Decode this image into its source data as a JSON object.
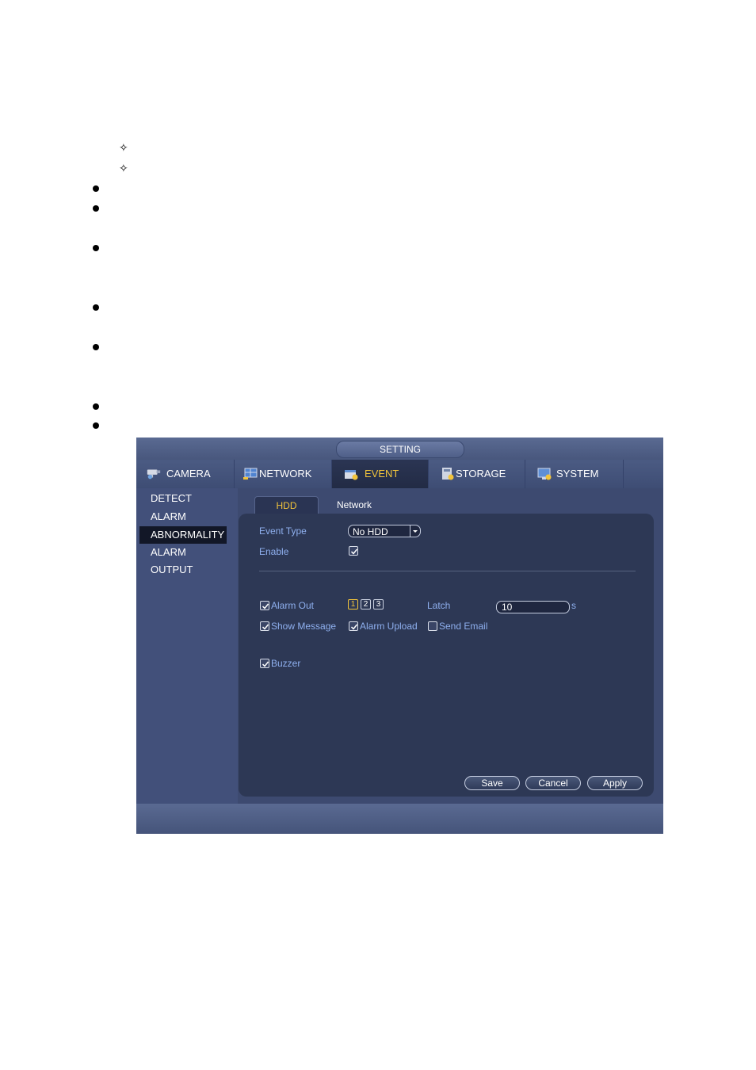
{
  "window": {
    "title": "SETTING",
    "tabs": [
      {
        "label": "CAMERA",
        "icon": "camera-icon"
      },
      {
        "label": "NETWORK",
        "icon": "network-icon"
      },
      {
        "label": "EVENT",
        "icon": "event-icon",
        "active": true
      },
      {
        "label": "STORAGE",
        "icon": "storage-icon"
      },
      {
        "label": "SYSTEM",
        "icon": "system-icon"
      }
    ],
    "sidebar": {
      "items": [
        {
          "label": "DETECT"
        },
        {
          "label": "ALARM"
        },
        {
          "label": "ABNORMALITY",
          "active": true
        },
        {
          "label": "ALARM OUTPUT"
        }
      ]
    },
    "subtabs": [
      {
        "label": "HDD",
        "active": true
      },
      {
        "label": "Network"
      }
    ],
    "form": {
      "event_type_label": "Event Type",
      "event_type_value": "No HDD",
      "enable_label": "Enable",
      "enable_checked": true,
      "alarm_out_label": "Alarm Out",
      "alarm_out_checked": true,
      "channels": [
        "1",
        "2",
        "3"
      ],
      "selected_channel": "1",
      "latch_label": "Latch",
      "latch_value": "10",
      "latch_unit": "s",
      "show_message_label": "Show Message",
      "show_message_checked": true,
      "alarm_upload_label": "Alarm Upload",
      "alarm_upload_checked": true,
      "send_email_label": "Send Email",
      "send_email_checked": false,
      "buzzer_label": "Buzzer",
      "buzzer_checked": true
    },
    "buttons": {
      "save": "Save",
      "cancel": "Cancel",
      "apply": "Apply"
    }
  },
  "colors": {
    "accent": "#f2c43b",
    "label_blue": "#8fb0ef",
    "panel": "#2d3855"
  }
}
